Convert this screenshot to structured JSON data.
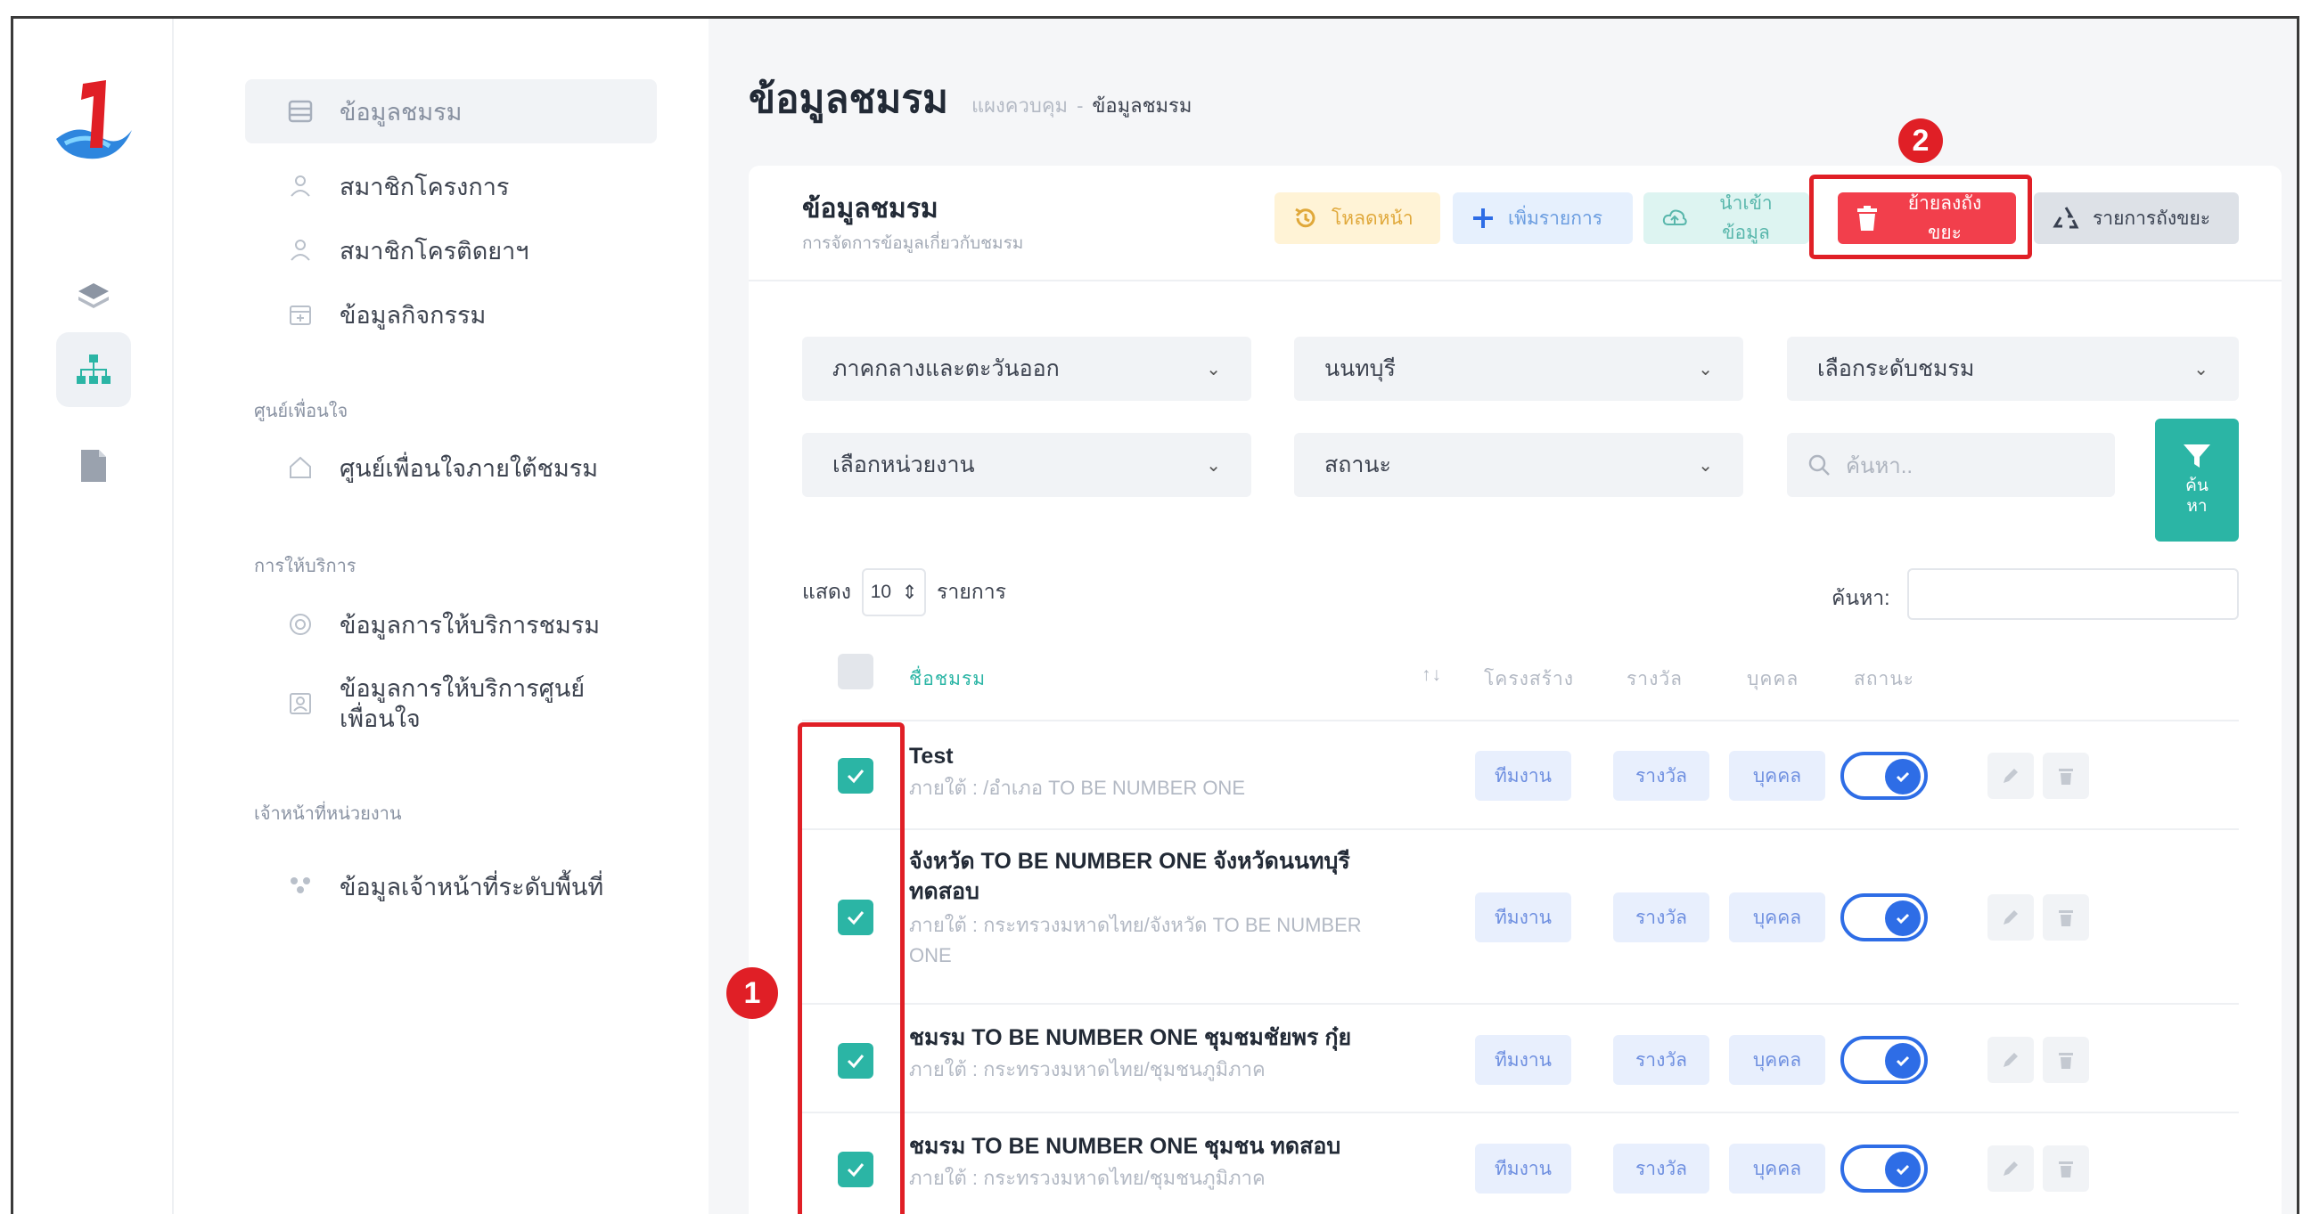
{
  "rail": {
    "icons": [
      "layers-icon",
      "sitemap-icon",
      "document-icon"
    ]
  },
  "sidebar": {
    "items": [
      {
        "label": "ข้อมูลชมรม",
        "icon": "database-icon"
      },
      {
        "label": "สมาชิกโครงการ",
        "icon": "group-icon"
      },
      {
        "label": "สมาชิกโครติดยาฯ",
        "icon": "group-icon"
      },
      {
        "label": "ข้อมูลกิจกรรม",
        "icon": "calendar-icon"
      }
    ],
    "section1_heading": "ศูนย์เพื่อนใจ",
    "section1_items": [
      {
        "label": "ศูนย์เพื่อนใจภายใต้ชมรม",
        "icon": "home-icon"
      }
    ],
    "section2_heading": "การให้บริการ",
    "section2_items": [
      {
        "label": "ข้อมูลการให้บริการชมรม",
        "icon": "target-icon"
      },
      {
        "label": "ข้อมูลการให้บริการศูนย์",
        "label2": "เพื่อนใจ",
        "icon": "id-card-icon"
      }
    ],
    "section3_heading": "เจ้าหน้าที่หน่วยงาน",
    "section3_items": [
      {
        "label": "ข้อมูลเจ้าหน้าที่ระดับพื้นที่",
        "icon": "staff-icon"
      }
    ]
  },
  "header": {
    "title": "ข้อมูลชมรม",
    "breadcrumb_home": "แผงควบคุม",
    "breadcrumb_sep": "-",
    "breadcrumb_current": "ข้อมูลชมรม"
  },
  "card": {
    "title": "ข้อมูลชมรม",
    "subtitle": "การจัดการข้อมูลเกี่ยวกับชมรม",
    "buttons": {
      "reload": "โหลดหน้า",
      "add": "เพิ่มรายการ",
      "import": "นำเข้าข้อมูล",
      "trash": "ย้ายลงถังขยะ",
      "recycle": "รายการถังขยะ"
    },
    "annotation_1": "1",
    "annotation_2": "2"
  },
  "filters": {
    "region": "ภาคกลางและตะวันออก",
    "province": "นนทบุรี",
    "level_placeholder": "เลือกระดับชมรม",
    "unit_placeholder": "เลือกหน่วยงาน",
    "status_placeholder": "สถานะ",
    "search_placeholder": "ค้นหา..",
    "filter_button_line1": "ค้น",
    "filter_button_line2": "หา"
  },
  "table_controls": {
    "show_label": "แสดง",
    "page_size": "10",
    "page_size_arrow": "⇕",
    "entries_label": "รายการ",
    "search_label": "ค้นหา:"
  },
  "table": {
    "columns": {
      "name": "ชื่อชมรม",
      "sort_icon": "↑↓",
      "structure": "โครงสร้าง",
      "award": "รางวัล",
      "person": "บุคคล",
      "status": "สถานะ"
    },
    "rows": [
      {
        "name": "Test",
        "name2": "",
        "sub": "ภายใต้ : /อำเภอ TO BE NUMBER ONE",
        "sub2": "",
        "structure": "ทีมงาน",
        "award": "รางวัล",
        "person": "บุคคล",
        "checked": true,
        "active": true
      },
      {
        "name": "จังหวัด TO BE NUMBER ONE จังหวัดนนทบุรี",
        "name2": "ทดสอบ",
        "sub": "ภายใต้ : กระทรวงมหาดไทย/จังหวัด TO BE NUMBER",
        "sub2": "ONE",
        "structure": "ทีมงาน",
        "award": "รางวัล",
        "person": "บุคคล",
        "checked": true,
        "active": true
      },
      {
        "name": "ชมรม TO BE NUMBER ONE ชุมชมชัยพร กุ๋ย",
        "name2": "",
        "sub": "ภายใต้ : กระทรวงมหาดไทย/ชุมชนภูมิภาค",
        "sub2": "",
        "structure": "ทีมงาน",
        "award": "รางวัล",
        "person": "บุคคล",
        "checked": true,
        "active": true
      },
      {
        "name": "ชมรม TO BE NUMBER ONE ชุมชน ทดสอบ",
        "name2": "",
        "sub": "ภายใต้ : กระทรวงมหาดไทย/ชุมชนภูมิภาค",
        "sub2": "",
        "structure": "ทีมงาน",
        "award": "รางวัล",
        "person": "บุคคล",
        "checked": true,
        "active": true
      }
    ]
  },
  "colors": {
    "accent_teal": "#2bb5a5",
    "danger_red": "#f23f4c",
    "annotation_red": "#e01f26",
    "toggle_blue": "#2e6de6"
  }
}
